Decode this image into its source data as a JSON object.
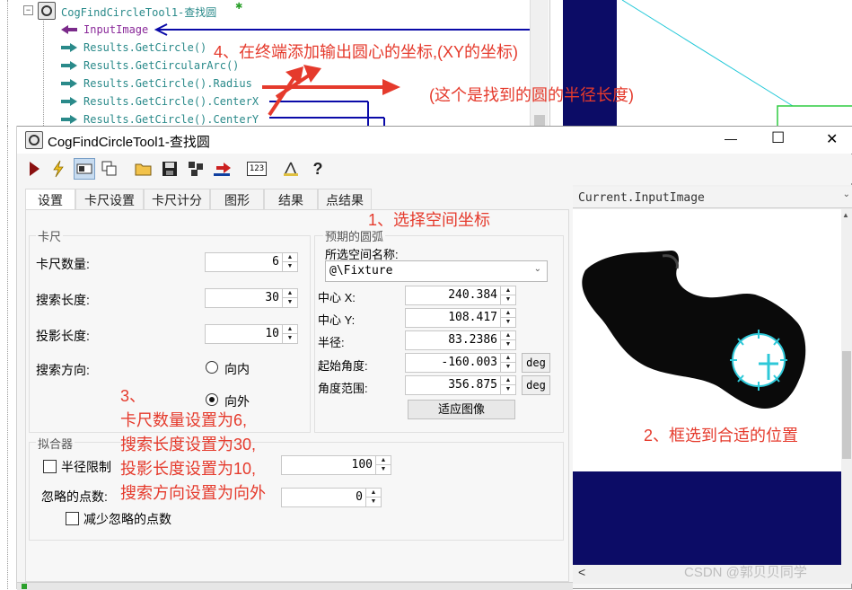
{
  "tree": {
    "tool_name": "CogFindCircleTool1-查找圆",
    "items": [
      "InputImage",
      "Results.GetCircle()",
      "Results.GetCircularArc()",
      "Results.GetCircle().Radius",
      "Results.GetCircle().CenterX",
      "Results.GetCircle().CenterY"
    ]
  },
  "annotations": {
    "note1": "1、选择空间坐标",
    "note2": "2、框选到合适的位置",
    "note3_lines": [
      "3、",
      "卡尺数量设置为6,",
      "搜索长度设置为30,",
      "投影长度设置为10,",
      "搜索方向设置为向外"
    ],
    "note4": "4、在终端添加输出圆心的坐标,(XY的坐标)",
    "note_radius": "(这个是找到的圆的半径长度)"
  },
  "window": {
    "title": "CogFindCircleTool1-查找圆",
    "controls": {
      "minimize": "—",
      "maximize": "☐",
      "close": "✕"
    }
  },
  "toolbar": {
    "icons": [
      "run-icon",
      "electric-run-icon",
      "display-icon",
      "copy-icon",
      "open-icon",
      "save-icon",
      "layout-icon",
      "reset-icon",
      "counter-icon",
      "measure-icon",
      "help-icon"
    ],
    "counter_text": "123"
  },
  "tabs": [
    "设置",
    "卡尺设置",
    "卡尺计分",
    "图形",
    "结果",
    "点结果"
  ],
  "caliper": {
    "legend": "卡尺",
    "count_label": "卡尺数量:",
    "count_value": "6",
    "search_label": "搜索长度:",
    "search_value": "30",
    "projection_label": "投影长度:",
    "projection_value": "10",
    "direction_label": "搜索方向:",
    "inward_label": "向内",
    "outward_label": "向外",
    "selected_direction": "outward"
  },
  "arc": {
    "legend": "预期的圆弧",
    "space_label": "所选空间名称:",
    "space_value": "@\\Fixture",
    "center_x_label": "中心 X:",
    "center_x_value": "240.384",
    "center_y_label": "中心 Y:",
    "center_y_value": "108.417",
    "radius_label": "半径:",
    "radius_value": "83.2386",
    "start_label": "起始角度:",
    "start_value": "-160.003",
    "range_label": "角度范围:",
    "range_value": "356.875",
    "deg_label": "deg",
    "fit_button": "适应图像"
  },
  "fitter": {
    "legend": "拟合器",
    "radius_limit_label": "半径限制",
    "radius_limit_value": "100",
    "ignore_label": "忽略的点数:",
    "ignore_value": "0",
    "reduce_label": "减少忽略的点数"
  },
  "image_panel": {
    "dropdown": "Current.InputImage",
    "scroll_left": "<"
  },
  "watermark": "CSDN @郭贝贝同学",
  "colors": {
    "tree_text": "#2a8a8a",
    "input_arrow": "#7a2a8a",
    "link_blue": "#0a0aa8",
    "annotation_red": "#e53a2c",
    "circle_cyan": "#2ec8d8",
    "dark_navy": "#0c0c66"
  }
}
